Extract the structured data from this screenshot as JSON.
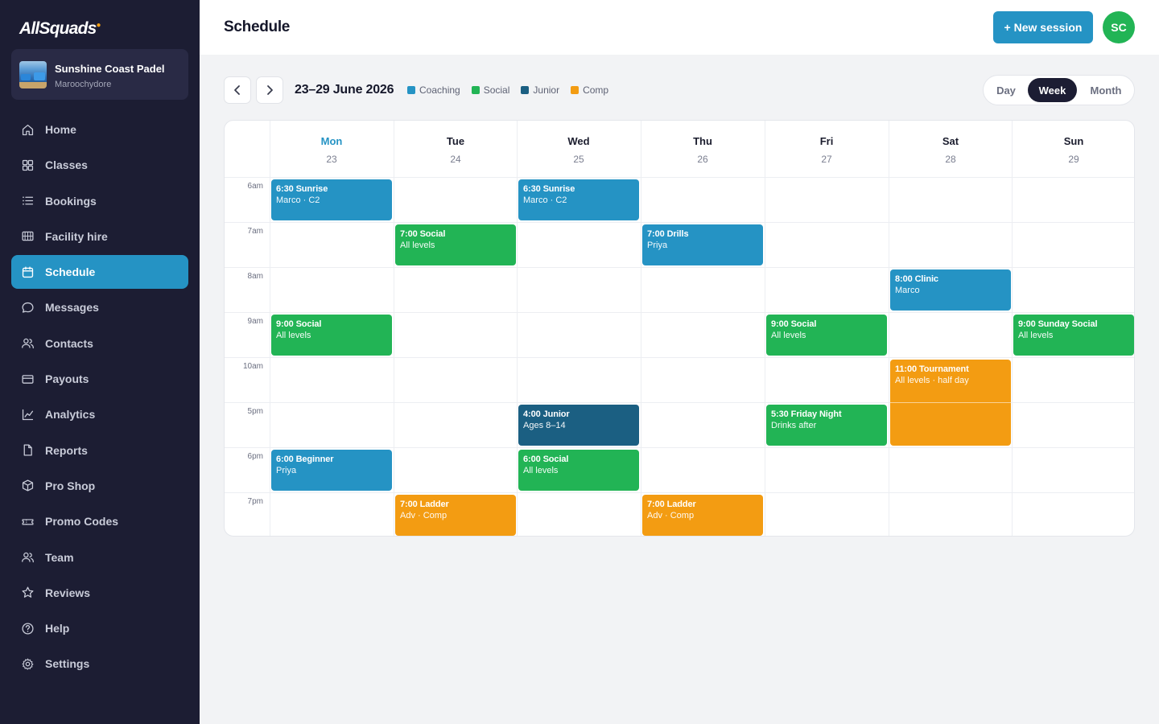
{
  "app": {
    "brand": "AllSquads",
    "club_name": "Sunshine Coast Padel",
    "club_location": "Maroochydore"
  },
  "sidebar": {
    "items": [
      {
        "label": "Home",
        "icon": "home-icon",
        "active": false
      },
      {
        "label": "Classes",
        "icon": "grid-icon",
        "active": false
      },
      {
        "label": "Bookings",
        "icon": "list-icon",
        "active": false
      },
      {
        "label": "Facility hire",
        "icon": "court-icon",
        "active": false
      },
      {
        "label": "Schedule",
        "icon": "calendar-icon",
        "active": true
      },
      {
        "label": "Messages",
        "icon": "message-icon",
        "active": false
      },
      {
        "label": "Contacts",
        "icon": "contacts-icon",
        "active": false
      },
      {
        "label": "Payouts",
        "icon": "card-icon",
        "active": false
      },
      {
        "label": "Analytics",
        "icon": "chart-icon",
        "active": false
      },
      {
        "label": "Reports",
        "icon": "file-icon",
        "active": false
      },
      {
        "label": "Pro Shop",
        "icon": "box-icon",
        "active": false
      },
      {
        "label": "Promo Codes",
        "icon": "ticket-icon",
        "active": false
      },
      {
        "label": "Team",
        "icon": "team-icon",
        "active": false
      },
      {
        "label": "Reviews",
        "icon": "star-icon",
        "active": false
      },
      {
        "label": "Help",
        "icon": "help-icon",
        "active": false
      },
      {
        "label": "Settings",
        "icon": "gear-icon",
        "active": false
      }
    ]
  },
  "header": {
    "title": "Schedule",
    "new_session_label": "+ New session",
    "avatar_initials": "SC"
  },
  "toolbar": {
    "range_label": "23–29 June 2026",
    "legend": [
      {
        "label": "Coaching",
        "color": "#2593c4"
      },
      {
        "label": "Social",
        "color": "#22b455"
      },
      {
        "label": "Junior",
        "color": "#1b5f82"
      },
      {
        "label": "Comp",
        "color": "#f39c12"
      }
    ],
    "views": [
      "Day",
      "Week",
      "Month"
    ],
    "active_view": "Week"
  },
  "calendar": {
    "days": [
      {
        "name": "Mon",
        "date": "23",
        "today": true
      },
      {
        "name": "Tue",
        "date": "24",
        "today": false
      },
      {
        "name": "Wed",
        "date": "25",
        "today": false
      },
      {
        "name": "Thu",
        "date": "26",
        "today": false
      },
      {
        "name": "Fri",
        "date": "27",
        "today": false
      },
      {
        "name": "Sat",
        "date": "28",
        "today": false
      },
      {
        "name": "Sun",
        "date": "29",
        "today": false
      }
    ],
    "time_slots": [
      "6am",
      "7am",
      "8am",
      "9am",
      "10am",
      "5pm",
      "6pm",
      "7pm"
    ],
    "events": [
      {
        "day": 0,
        "slot": 0,
        "span": 1,
        "title": "6:30 Sunrise",
        "subtitle": "Marco · C2",
        "type": "coaching"
      },
      {
        "day": 2,
        "slot": 0,
        "span": 1,
        "title": "6:30 Sunrise",
        "subtitle": "Marco · C2",
        "type": "coaching"
      },
      {
        "day": 1,
        "slot": 1,
        "span": 1,
        "title": "7:00 Social",
        "subtitle": "All levels",
        "type": "social"
      },
      {
        "day": 3,
        "slot": 1,
        "span": 1,
        "title": "7:00 Drills",
        "subtitle": "Priya",
        "type": "coaching"
      },
      {
        "day": 5,
        "slot": 2,
        "span": 1,
        "title": "8:00 Clinic",
        "subtitle": "Marco",
        "type": "coaching"
      },
      {
        "day": 0,
        "slot": 3,
        "span": 1,
        "title": "9:00 Social",
        "subtitle": "All levels",
        "type": "social"
      },
      {
        "day": 4,
        "slot": 3,
        "span": 1,
        "title": "9:00 Social",
        "subtitle": "All levels",
        "type": "social"
      },
      {
        "day": 6,
        "slot": 3,
        "span": 1,
        "title": "9:00 Sunday Social",
        "subtitle": "All levels",
        "type": "social"
      },
      {
        "day": 5,
        "slot": 4,
        "span": 2,
        "title": "11:00 Tournament",
        "subtitle": "All levels · half day",
        "type": "comp"
      },
      {
        "day": 2,
        "slot": 5,
        "span": 1,
        "title": "4:00 Junior",
        "subtitle": "Ages 8–14",
        "type": "junior"
      },
      {
        "day": 4,
        "slot": 5,
        "span": 1,
        "title": "5:30 Friday Night",
        "subtitle": "Drinks after",
        "type": "social"
      },
      {
        "day": 0,
        "slot": 6,
        "span": 1,
        "title": "6:00 Beginner",
        "subtitle": "Priya",
        "type": "coaching"
      },
      {
        "day": 2,
        "slot": 6,
        "span": 1,
        "title": "6:00 Social",
        "subtitle": "All levels",
        "type": "social"
      },
      {
        "day": 1,
        "slot": 7,
        "span": 1,
        "title": "7:00 Ladder",
        "subtitle": "Adv · Comp",
        "type": "comp"
      },
      {
        "day": 3,
        "slot": 7,
        "span": 1,
        "title": "7:00 Ladder",
        "subtitle": "Adv · Comp",
        "type": "comp"
      }
    ]
  },
  "colors": {
    "coaching": "#2593c4",
    "social": "#22b455",
    "junior": "#1b5f82",
    "comp": "#f39c12"
  }
}
